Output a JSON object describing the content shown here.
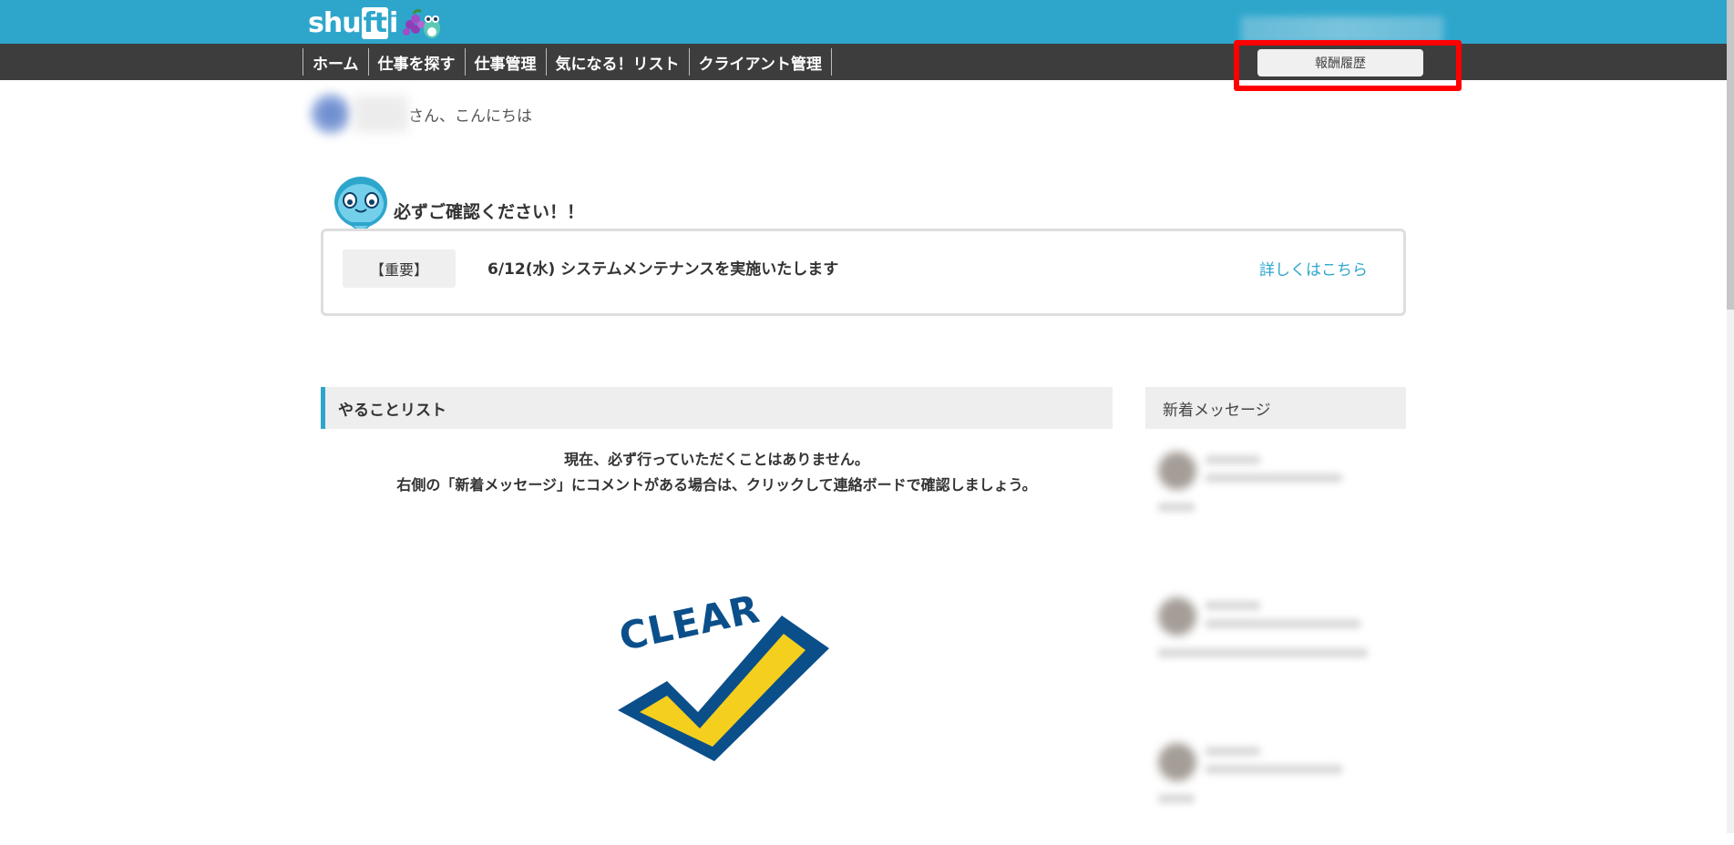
{
  "header": {
    "logo_text_a": "shu",
    "logo_text_b": "ft",
    "logo_text_c": "i",
    "logo_icon": "grape-frog-icon"
  },
  "nav": {
    "items": [
      {
        "label": "ホーム"
      },
      {
        "label": "仕事を探す"
      },
      {
        "label": "仕事管理"
      },
      {
        "label": "気になる！リスト"
      },
      {
        "label": "クライアント管理"
      }
    ],
    "reward_history_label": "報酬履歴"
  },
  "greeting": {
    "text": "さん、こんにちは"
  },
  "notice": {
    "title": "必ずご確認ください！！",
    "tag": "【重要】",
    "message": "6/12(水) システムメンテナンスを実施いたします",
    "link": "詳しくはこちら"
  },
  "todo": {
    "title": "やることリスト",
    "line1": "現在、必ず行っていただくことはありません。",
    "line2": "右側の「新着メッセージ」にコメントがある場合は、クリックして連絡ボードで確認しましょう。",
    "graphic_word": "CLEAR"
  },
  "messages": {
    "title": "新着メッセージ"
  },
  "colors": {
    "brand": "#2ea6cc",
    "nav_bg": "#3d3d3d",
    "highlight": "#ff0000",
    "clear_blue": "#0b4f8a",
    "clear_yellow": "#f5cf1d"
  }
}
